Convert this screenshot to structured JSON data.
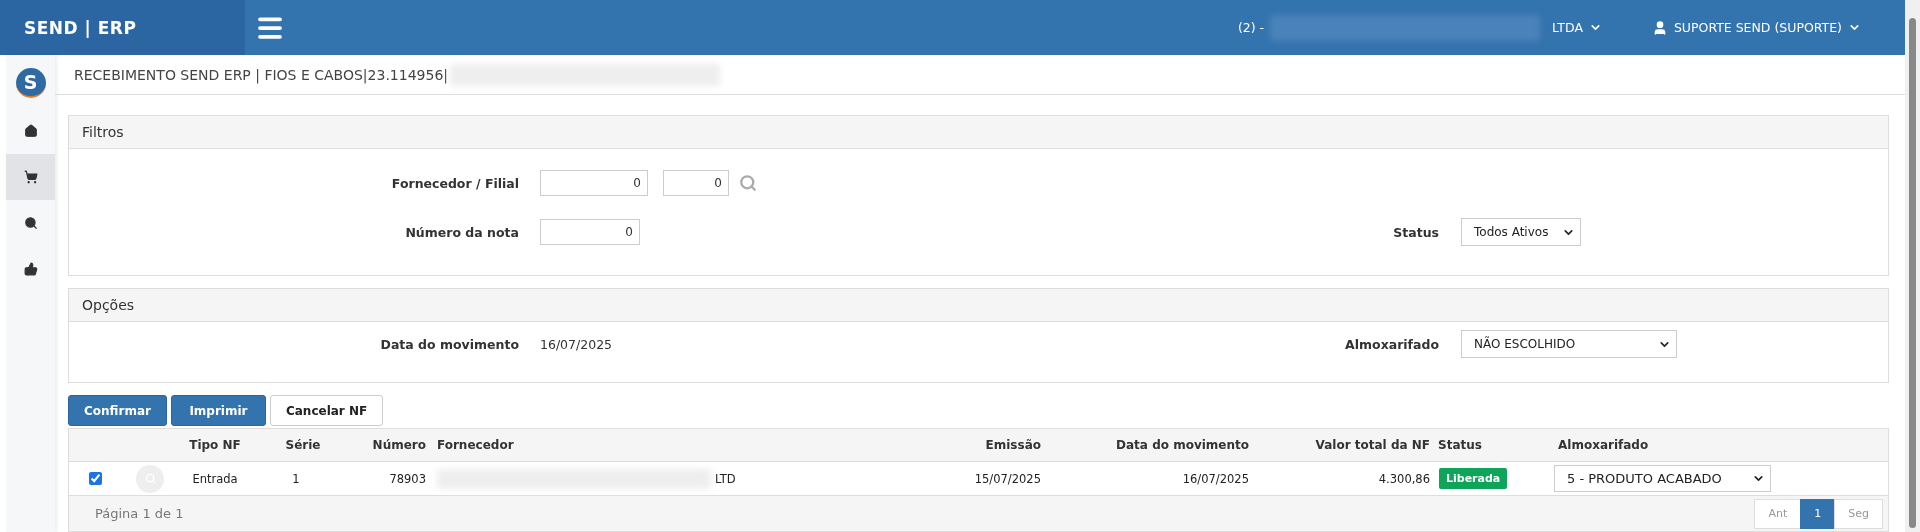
{
  "topbar": {
    "brand": "SEND | ERP",
    "company_prefix": "(2) -",
    "company_suffix": "LTDA",
    "user": "SUPORTE SEND (SUPORTE)"
  },
  "sidebar": {
    "logo": "S",
    "items": [
      {
        "selected": false
      },
      {
        "selected": true
      },
      {
        "selected": false
      },
      {
        "selected": false
      }
    ]
  },
  "page_title": "RECEBIMENTO SEND ERP | FIOS E CABOS|23.114956|",
  "filters": {
    "title": "Filtros",
    "supplier_label": "Fornecedor / Filial",
    "supplier_value": "0",
    "branch_value": "0",
    "note_label": "Número da nota",
    "note_value": "0",
    "status_label": "Status",
    "status_value": "Todos Ativos"
  },
  "options": {
    "title": "Opções",
    "date_label": "Data do movimento",
    "date_value": "16/07/2025",
    "warehouse_label": "Almoxarifado",
    "warehouse_value": "NÃO ESCOLHIDO"
  },
  "buttons": [
    {
      "label": "Confirmar",
      "kind": "primary"
    },
    {
      "label": "Imprimir",
      "kind": "primary"
    },
    {
      "label": "Cancelar NF",
      "kind": "default"
    }
  ],
  "table": {
    "columns": [
      "",
      "",
      "Tipo NF",
      "Série",
      "Número",
      "Fornecedor",
      "Emissão",
      "Data do movimento",
      "Valor total da NF",
      "Status",
      "Almoxarifado"
    ],
    "rows": [
      {
        "checked": true,
        "tipo": "Entrada",
        "serie": "1",
        "numero": "78903",
        "fornecedor": "LTD",
        "emissao": "15/07/2025",
        "data": "16/07/2025",
        "valor": "4.300,86",
        "status": "Liberada",
        "color": "#0ea55a",
        "almoxarifado": "5 - PRODUTO ACABADO"
      }
    ],
    "footer": "Página 1 de 1",
    "pagination": [
      {
        "label": "Ant",
        "selected": false,
        "disabled": true
      },
      {
        "label": "1",
        "selected": true,
        "disabled": false
      },
      {
        "label": "Seg",
        "selected": false,
        "disabled": true
      }
    ]
  }
}
